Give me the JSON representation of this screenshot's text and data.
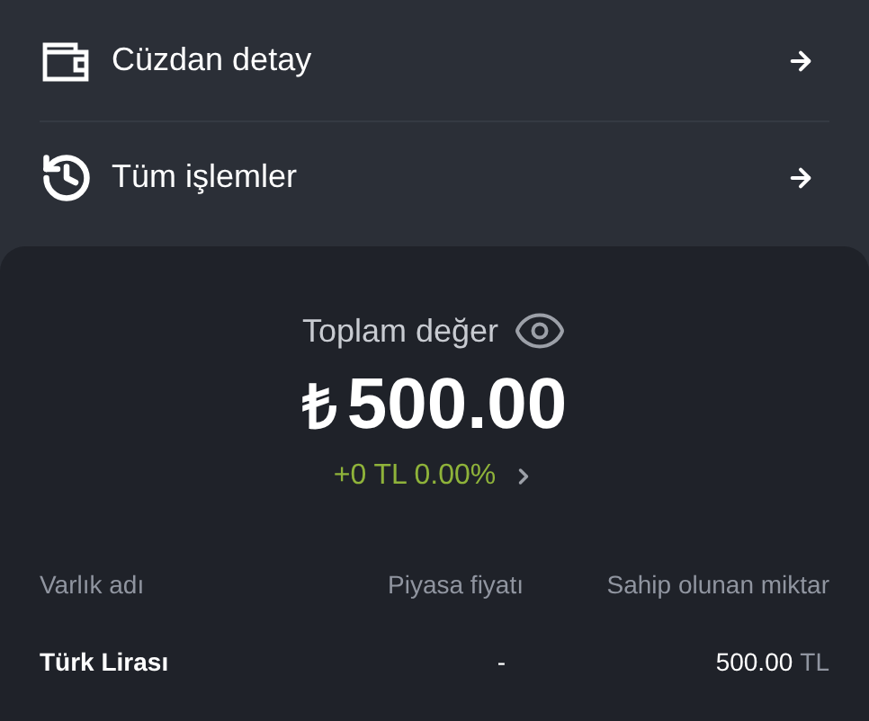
{
  "menu": [
    {
      "kind": "wallet",
      "label": "Cüzdan detay"
    },
    {
      "kind": "history",
      "label": "Tüm işlemler"
    }
  ],
  "summary": {
    "label": "Toplam değer",
    "currency_symbol": "₺",
    "amount": "500.00",
    "change": "+0 TL 0.00%"
  },
  "table": {
    "columns": [
      "Varlık adı",
      "Piyasa fiyatı",
      "Sahip olunan miktar"
    ],
    "rows": [
      {
        "name": "Türk Lirası",
        "price": "-",
        "amount": "500.00",
        "unit": "TL"
      }
    ]
  }
}
